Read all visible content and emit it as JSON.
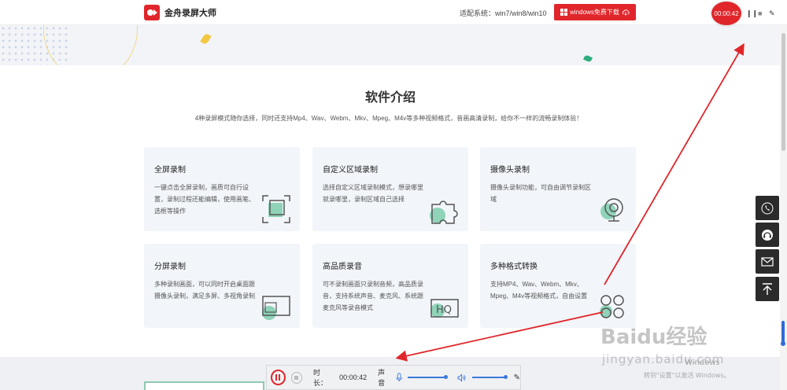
{
  "header": {
    "logo_text": "金舟录屏大师",
    "system_label": "适配系统：win7/win8/win10",
    "download_label": "windows免费下载"
  },
  "recorder_overlay": {
    "timer": "00:00:42"
  },
  "intro": {
    "title": "软件介绍",
    "subtitle": "4种录屏模式随你选择，同时还支持Mp4、Wav、Webm、Mkv、Mpeg、M4v等多种视频格式，音画高清录制，给你不一样的流畅录制体验！"
  },
  "cards": [
    {
      "title": "全屏录制",
      "desc": "一键点击全屏录制，画质可自行设置，录制过程还能编辑，使用画笔、选框等操作",
      "icon": "fullscreen-icon"
    },
    {
      "title": "自定义区域录制",
      "desc": "选择自定义区域录制模式，想录哪里就录哪里，录制区域自己选择",
      "icon": "puzzle-icon"
    },
    {
      "title": "摄像头录制",
      "desc": "摄像头录制功能，可自由调节录制区域",
      "icon": "webcam-icon"
    },
    {
      "title": "分屏录制",
      "desc": "多种录制画面，可以同时开启桌面跟摄像头录制，满足多屏、多视角录制",
      "icon": "split-screen-icon"
    },
    {
      "title": "高品质录音",
      "desc": "可不录制画面只录制音频，高品质录音，支持系统声音、麦克风、系统跟麦克风等录音模式",
      "icon": "hq-audio-icon"
    },
    {
      "title": "多种格式转换",
      "desc": "支持MP4、Wav、Webm、Mkv、Mpeg、M4v等视频格式，自由设置",
      "icon": "formats-icon"
    }
  ],
  "float_toolbar": [
    "phone-icon",
    "headset-icon",
    "mail-icon",
    "back-to-top-icon"
  ],
  "recording_bar": {
    "duration_label": "时长：",
    "duration_value": "00:00:42",
    "sound_label": "声音"
  },
  "watermark": {
    "brand": "Baidu经验",
    "url": "jingyan.baidu.com",
    "activation_title": "Windows",
    "activation_sub": "转到\"设置\"以激活 Windows。"
  },
  "colors": {
    "accent_red": "#e0262b",
    "card_bg": "#f2f5fa",
    "icon_green": "#8fd3b8",
    "slider_blue": "#3b79d9"
  }
}
